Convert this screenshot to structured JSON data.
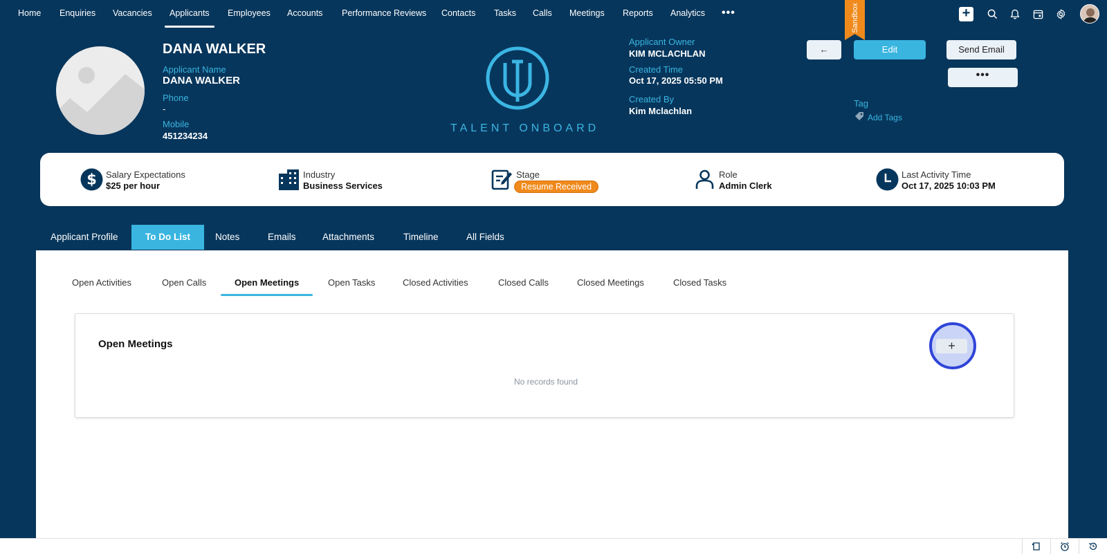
{
  "nav": {
    "items": [
      "Home",
      "Enquiries",
      "Vacancies",
      "Applicants",
      "Employees",
      "Accounts",
      "Performance Reviews",
      "Contacts",
      "Tasks",
      "Calls",
      "Meetings",
      "Reports",
      "Analytics"
    ],
    "active": "Applicants",
    "more": "•••",
    "sandbox": "Sandbox"
  },
  "header": {
    "name": "DANA WALKER",
    "applicant_name_label": "Applicant Name",
    "applicant_name": "DANA WALKER",
    "phone_label": "Phone",
    "phone": "-",
    "mobile_label": "Mobile",
    "mobile": "451234234",
    "logo_text": "TALENT ONBOARD",
    "owner_label": "Applicant Owner",
    "owner": "KIM MCLACHLAN",
    "created_time_label": "Created Time",
    "created_time": "Oct 17, 2025 05:50 PM",
    "created_by_label": "Created By",
    "created_by": "Kim Mclachlan",
    "tag_label": "Tag",
    "add_tags": "Add Tags",
    "back_icon": "←",
    "edit": "Edit",
    "send_email": "Send Email",
    "more": "•••"
  },
  "summary": {
    "salary_label": "Salary Expectations",
    "salary": "$25 per hour",
    "industry_label": "Industry",
    "industry": "Business Services",
    "stage_label": "Stage",
    "stage": "Resume Received",
    "role_label": "Role",
    "role": "Admin Clerk",
    "activity_label": "Last Activity Time",
    "activity": "Oct 17, 2025 10:03 PM"
  },
  "tabs": [
    "Applicant Profile",
    "To Do List",
    "Notes",
    "Emails",
    "Attachments",
    "Timeline",
    "All Fields"
  ],
  "active_tab": "To Do List",
  "subtabs": [
    "Open Activities",
    "Open Calls",
    "Open Meetings",
    "Open Tasks",
    "Closed Activities",
    "Closed Calls",
    "Closed Meetings",
    "Closed Tasks"
  ],
  "active_subtab": "Open Meetings",
  "panel": {
    "title": "Open Meetings",
    "empty": "No records found",
    "add": "+"
  },
  "colors": {
    "background": "#07365c",
    "accent": "#39b5e0",
    "stage": "#f08a1c",
    "highlight_ring": "#2f44d8"
  }
}
